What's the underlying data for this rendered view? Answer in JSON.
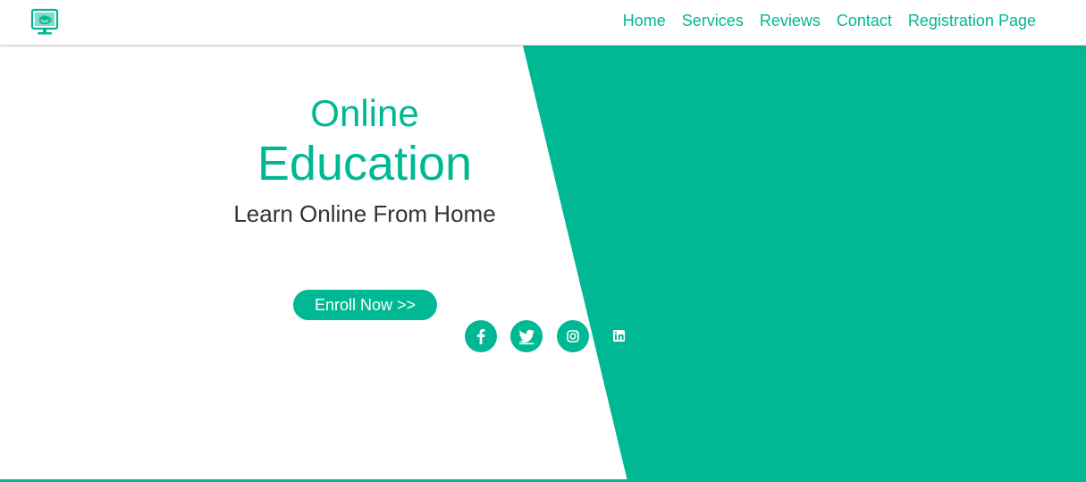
{
  "colors": {
    "accent": "#00b894",
    "text": "#333333",
    "background": "#ffffff"
  },
  "logo": {
    "icon": "computer-education-icon"
  },
  "nav": {
    "items": [
      {
        "label": "Home"
      },
      {
        "label": "Services"
      },
      {
        "label": "Reviews"
      },
      {
        "label": "Contact"
      },
      {
        "label": "Registration Page"
      }
    ]
  },
  "hero": {
    "title_line1": "Online",
    "title_line2": "Education",
    "subtitle": "Learn Online From Home",
    "cta_label": "Enroll Now >>"
  },
  "social": [
    {
      "icon": "facebook-icon"
    },
    {
      "icon": "twitter-icon"
    },
    {
      "icon": "instagram-icon"
    },
    {
      "icon": "linkedin-icon"
    }
  ]
}
